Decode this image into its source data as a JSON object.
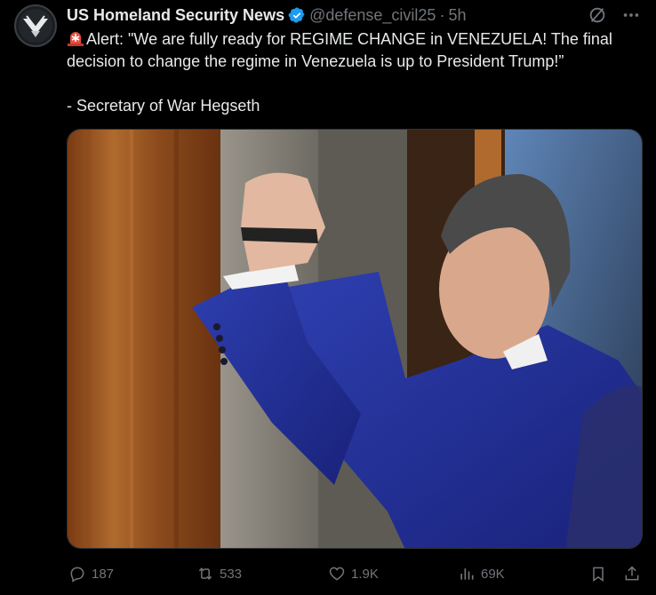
{
  "author": {
    "name": "US Homeland Security News",
    "handle": "@defense_civil25",
    "separator": "·",
    "time": "5h",
    "verified_color": "#1d9bf0",
    "avatar_icon": "shield-eagle-logo"
  },
  "tweet": {
    "line1": "Alert: \"We are fully ready for REGIME CHANGE in VENEZUELA! The final decision to change the regime in Venezuela is up to President Trump!”",
    "line2": "- Secretary of War Hegseth",
    "emoji_icon": "rotating-light-icon"
  },
  "media": {
    "image_icon": "photo-man-raising-fist"
  },
  "metrics": {
    "replies": "187",
    "reposts": "533",
    "likes": "1.9K",
    "views": "69K"
  },
  "colors": {
    "background": "#000000",
    "text": "#e7e9ea",
    "muted": "#71767b",
    "accent": "#1d9bf0"
  }
}
